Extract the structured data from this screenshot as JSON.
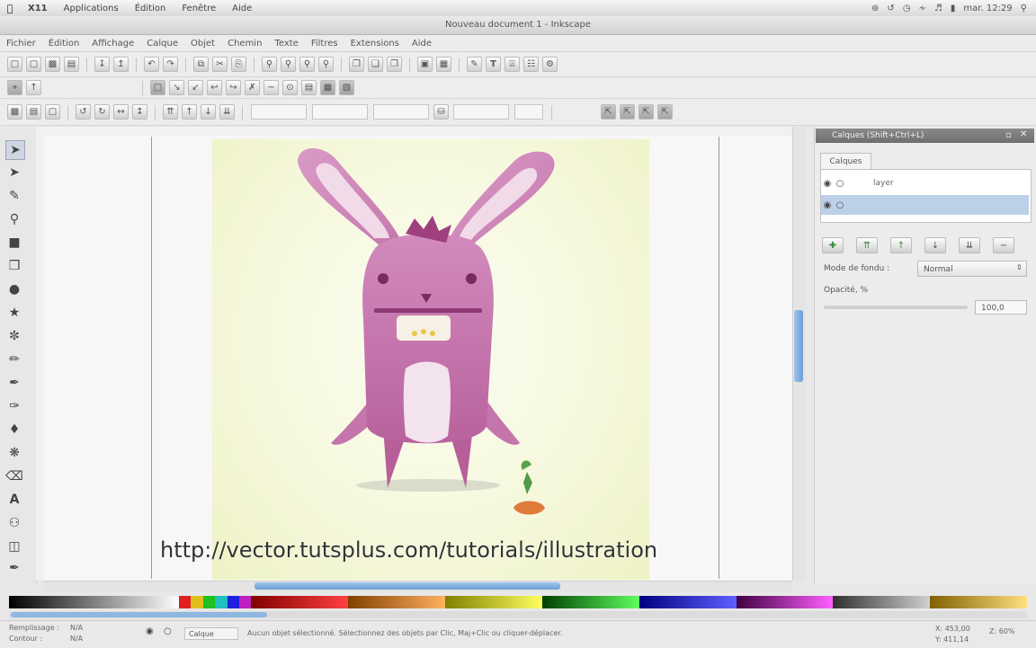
{
  "mac_menu": {
    "app": "X11",
    "items": [
      "Applications",
      "Édition",
      "Fenêtre",
      "Aide"
    ],
    "clock": "mar. 12:29"
  },
  "window_title": "Nouveau document 1 - Inkscape",
  "app_menu": [
    "Fichier",
    "Édition",
    "Affichage",
    "Calque",
    "Objet",
    "Chemin",
    "Texte",
    "Filtres",
    "Extensions",
    "Aide"
  ],
  "layers_panel": {
    "title": "Calques (Shift+Ctrl+L)",
    "tab": "Calques",
    "layers": [
      {
        "name": "layer",
        "selected": false
      },
      {
        "name": "",
        "selected": true
      }
    ],
    "blend_label": "Mode de fondu :",
    "blend_value": "Normal",
    "opacity_label": "Opacité, %",
    "opacity_value": "100,0"
  },
  "canvas": {
    "overlay_url": "http://vector.tutsplus.com/tutorials/illustration"
  },
  "statusbar": {
    "fill_label": "Remplissage :",
    "stroke_label": "Contour :",
    "fill_value": "N/A",
    "stroke_value": "N/A",
    "layer": "Calque",
    "message": "Aucun objet sélectionné. Sélectionnez des objets par Clic, Maj+Clic ou cliquer-déplacer.",
    "coords_x": "X: 453,00",
    "coords_y": "Y: 411,14",
    "zoom": "Z: 60%"
  },
  "colors": {
    "bunny": "#c97fb0",
    "bunny_dark": "#a9568f",
    "selection": "#bcd0e8",
    "scroll_thumb": "#6a9fd4"
  }
}
